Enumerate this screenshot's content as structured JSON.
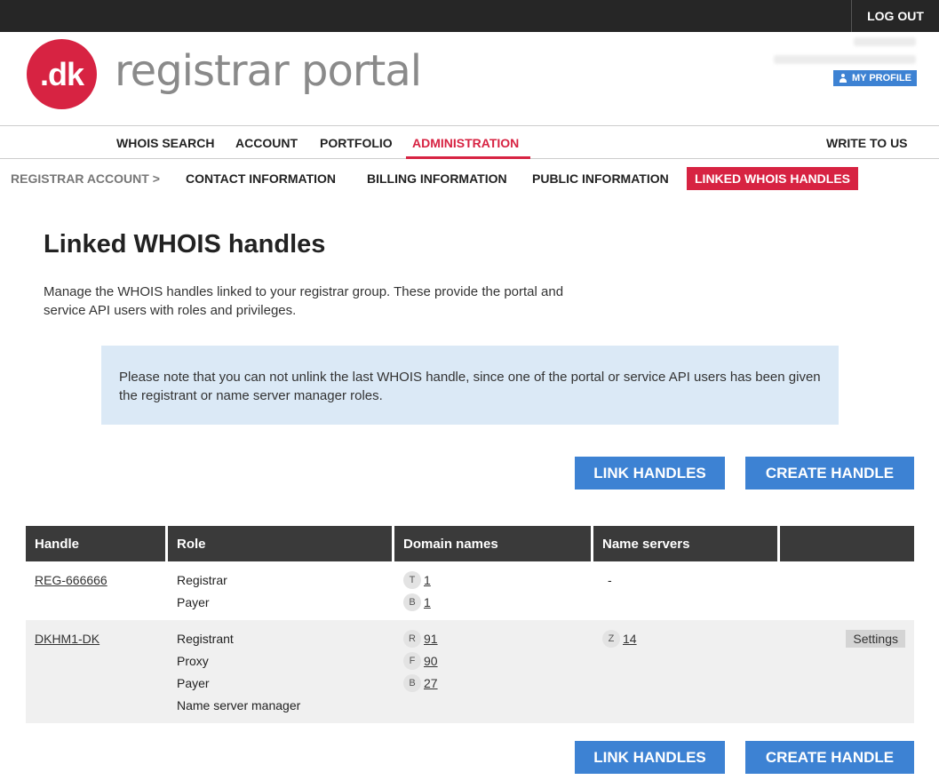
{
  "topbar": {
    "logout": "LOG OUT"
  },
  "brand": {
    "logo_mark": ".dk",
    "logo_text": "registrar portal"
  },
  "user": {
    "my_profile": "MY PROFILE"
  },
  "mainnav": {
    "items": [
      "WHOIS SEARCH",
      "ACCOUNT",
      "PORTFOLIO",
      "ADMINISTRATION"
    ],
    "active": "ADMINISTRATION",
    "write_to_us": "WRITE TO US"
  },
  "subnav": {
    "crumb": "REGISTRAR ACCOUNT >",
    "items": [
      "CONTACT INFORMATION",
      "BILLING INFORMATION",
      "PUBLIC INFORMATION",
      "LINKED WHOIS HANDLES"
    ],
    "active": "LINKED WHOIS HANDLES"
  },
  "page": {
    "title": "Linked WHOIS handles",
    "intro": "Manage the WHOIS handles linked to your registrar group. These provide the portal and service API users with roles and privileges.",
    "notice": "Please note that you can not unlink the last WHOIS handle, since one of the portal or service API users has been given the registrant or name server manager roles."
  },
  "buttons": {
    "link_handles": "LINK HANDLES",
    "create_handle": "CREATE HANDLE"
  },
  "table": {
    "headers": [
      "Handle",
      "Role",
      "Domain names",
      "Name servers",
      ""
    ],
    "rows": [
      {
        "handle": "REG-666666",
        "roles": [
          "Registrar",
          "Payer"
        ],
        "domains": [
          {
            "badge": "T",
            "count": "1"
          },
          {
            "badge": "B",
            "count": "1"
          }
        ],
        "nameservers": "-",
        "settings": ""
      },
      {
        "handle": "DKHM1-DK",
        "roles": [
          "Registrant",
          "Proxy",
          "Payer",
          "Name server manager"
        ],
        "domains": [
          {
            "badge": "R",
            "count": "91"
          },
          {
            "badge": "F",
            "count": "90"
          },
          {
            "badge": "B",
            "count": "27"
          }
        ],
        "ns_badge": "Z",
        "ns_count": "14",
        "settings": "Settings"
      }
    ]
  },
  "colors": {
    "brand_red": "#d72342",
    "button_blue": "#3d82d3",
    "notice_bg": "#dbe9f6",
    "header_dark": "#3a3a3a"
  }
}
